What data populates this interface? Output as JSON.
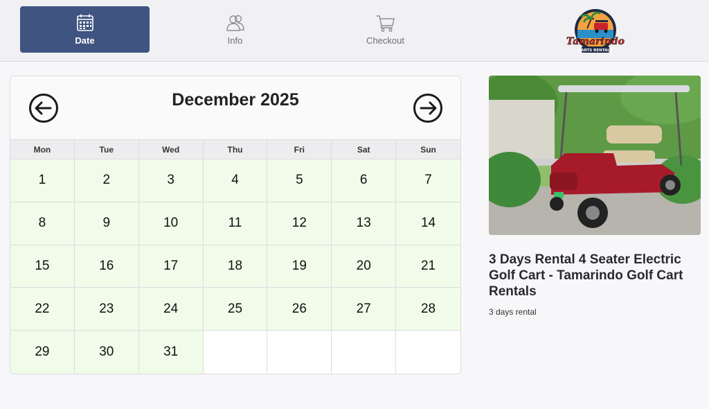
{
  "steps": [
    {
      "label": "Date",
      "icon": "calendar-icon",
      "active": true
    },
    {
      "label": "Info",
      "icon": "users-icon",
      "active": false
    },
    {
      "label": "Checkout",
      "icon": "cart-icon",
      "active": false
    }
  ],
  "logo": {
    "name": "Tamarindo",
    "tagline": "CARTS RENTALS"
  },
  "calendar": {
    "month_title": "December 2025",
    "prev_icon": "arrow-left-circle-icon",
    "next_icon": "arrow-right-circle-icon",
    "weekdays": [
      "Mon",
      "Tue",
      "Wed",
      "Thu",
      "Fri",
      "Sat",
      "Sun"
    ],
    "days": [
      "1",
      "2",
      "3",
      "4",
      "5",
      "6",
      "7",
      "8",
      "9",
      "10",
      "11",
      "12",
      "13",
      "14",
      "15",
      "16",
      "17",
      "18",
      "19",
      "20",
      "21",
      "22",
      "23",
      "24",
      "25",
      "26",
      "27",
      "28",
      "29",
      "30",
      "31",
      "",
      "",
      "",
      ""
    ]
  },
  "product": {
    "image": "golf-cart-photo",
    "title": "3 Days Rental 4 Seater Electric Golf Cart - Tamarindo Golf Cart Rentals",
    "subtitle": "3 days rental"
  },
  "colors": {
    "active_step": "#3f5480",
    "available_day": "#f0fce9"
  }
}
